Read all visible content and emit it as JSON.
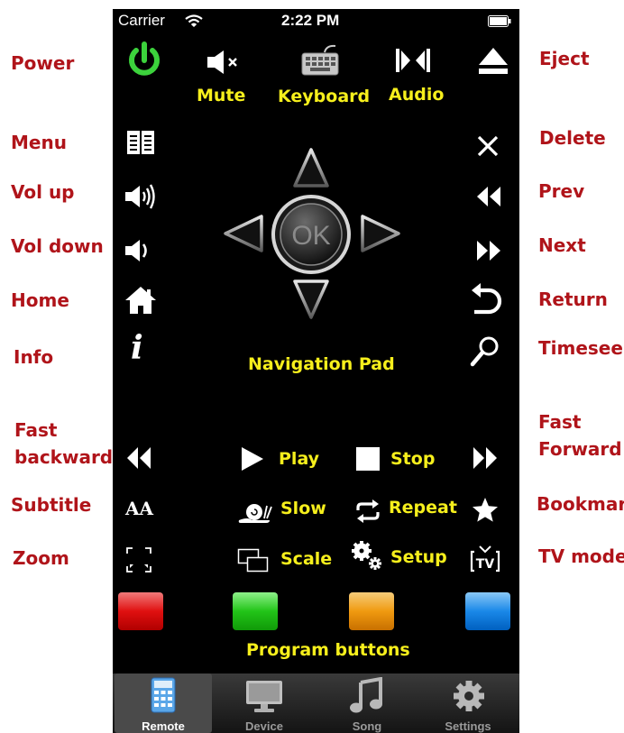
{
  "status_bar": {
    "carrier": "Carrier",
    "time": "2:22 PM"
  },
  "annotations_left": {
    "power": "Power",
    "menu": "Menu",
    "vol_up": "Vol up",
    "vol_down": "Vol down",
    "home": "Home",
    "info": "Info",
    "fast_backward_line1": "Fast",
    "fast_backward_line2": "backward",
    "subtitle": "Subtitle",
    "zoom": "Zoom"
  },
  "annotations_right": {
    "eject": "Eject",
    "delete": "Delete",
    "prev": "Prev",
    "next": "Next",
    "return": "Return",
    "timeseek": "Timeseek",
    "fast_forward_line1": "Fast",
    "fast_forward_line2": "Forward",
    "bookmark": "Bookmark",
    "tv_mode": "TV mode"
  },
  "top_labels": {
    "mute": "Mute",
    "keyboard": "Keyboard",
    "audio": "Audio"
  },
  "nav": {
    "ok": "OK",
    "caption": "Navigation Pad"
  },
  "playback": {
    "play": "Play",
    "stop": "Stop",
    "slow": "Slow",
    "repeat": "Repeat",
    "scale": "Scale",
    "setup": "Setup"
  },
  "subtitle_glyph": "AA",
  "program_caption": "Program buttons",
  "program_colors": [
    "#e01010",
    "#22c418",
    "#f09a10",
    "#1a88e8"
  ],
  "accent_power": "#3cd23c",
  "tabs": [
    {
      "label": "Remote",
      "icon": "calculator-icon"
    },
    {
      "label": "Device",
      "icon": "monitor-icon"
    },
    {
      "label": "Song",
      "icon": "music-note-icon"
    },
    {
      "label": "Settings",
      "icon": "gear-icon"
    }
  ]
}
